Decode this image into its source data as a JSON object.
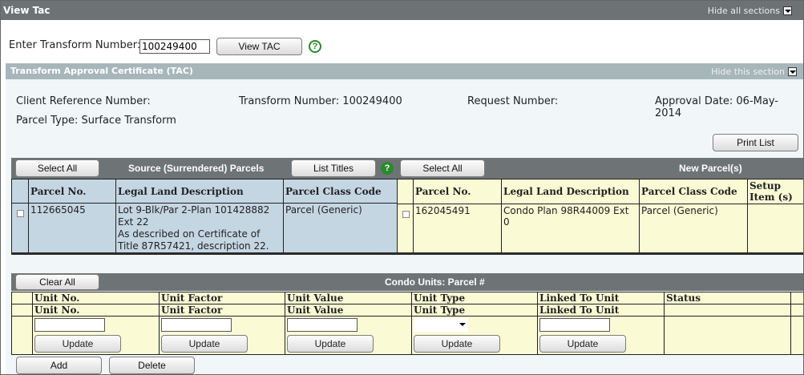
{
  "header": {
    "title": "View Tac",
    "hide_all": "Hide all sections"
  },
  "transform_lookup": {
    "label": "Enter Transform Number:",
    "value": "100249400",
    "button": "View TAC"
  },
  "tac": {
    "title": "Transform Approval Certificate (TAC)",
    "hide": "Hide this section",
    "client_ref": "Client Reference Number:",
    "transform_number": "Transform Number: 100249400",
    "request_number": "Request Number:",
    "approval_date": "Approval Date: 06-May-2014",
    "parcel_type": "Parcel Type: Surface Transform",
    "print_list": "Print List"
  },
  "source": {
    "select_all": "Select All",
    "title": "Source (Surrendered) Parcels",
    "list_titles": "List Titles",
    "columns": [
      "Parcel No.",
      "Legal Land Description",
      "Parcel Class Code"
    ],
    "rows": [
      {
        "parcel_no": "112665045",
        "legal": "Lot 9-Blk/Par 2-Plan 101428882 Ext 22\nAs described on Certificate of Title 87R57421, description 22.",
        "class_code": "Parcel (Generic)"
      }
    ]
  },
  "new_parcels": {
    "select_all": "Select All",
    "title": "New Parcel(s)",
    "columns": [
      "Parcel No.",
      "Legal Land Description",
      "Parcel Class Code",
      "Setup Item (s)"
    ],
    "rows": [
      {
        "parcel_no": "162045491",
        "legal": "Condo Plan 98R44009 Ext 0",
        "class_code": "Parcel (Generic)"
      }
    ]
  },
  "condo": {
    "clear_all": "Clear All",
    "title": "Condo Units: Parcel #",
    "header1": [
      "Unit No.",
      "Unit Factor",
      "Unit Value",
      "Unit Type",
      "Linked To Unit",
      "Status"
    ],
    "header2": [
      "Unit No.",
      "Unit Factor",
      "Unit Value",
      "Unit Type",
      "Linked To Unit"
    ],
    "update": "Update",
    "add": "Add",
    "delete": "Delete"
  }
}
